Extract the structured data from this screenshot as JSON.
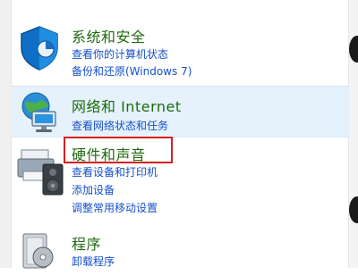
{
  "categories": [
    {
      "title": "系统和安全",
      "icon": "shield-icon",
      "links": [
        "查看你的计算机状态",
        "备份和还原(Windows 7)"
      ]
    },
    {
      "title": "网络和 Internet",
      "icon": "network-globe-icon",
      "links": [
        "查看网络状态和任务"
      ]
    },
    {
      "title": "硬件和声音",
      "icon": "printer-speaker-icon",
      "links": [
        "查看设备和打印机",
        "添加设备",
        "调整常用移动设置"
      ]
    },
    {
      "title": "程序",
      "icon": "programs-icon",
      "links": [
        "卸载程序"
      ]
    }
  ],
  "colors": {
    "title_green": "#1e6b0f",
    "link_blue": "#1450c8",
    "highlight_bg": "#e5f1fb",
    "annotation_red": "#d81e1e"
  }
}
